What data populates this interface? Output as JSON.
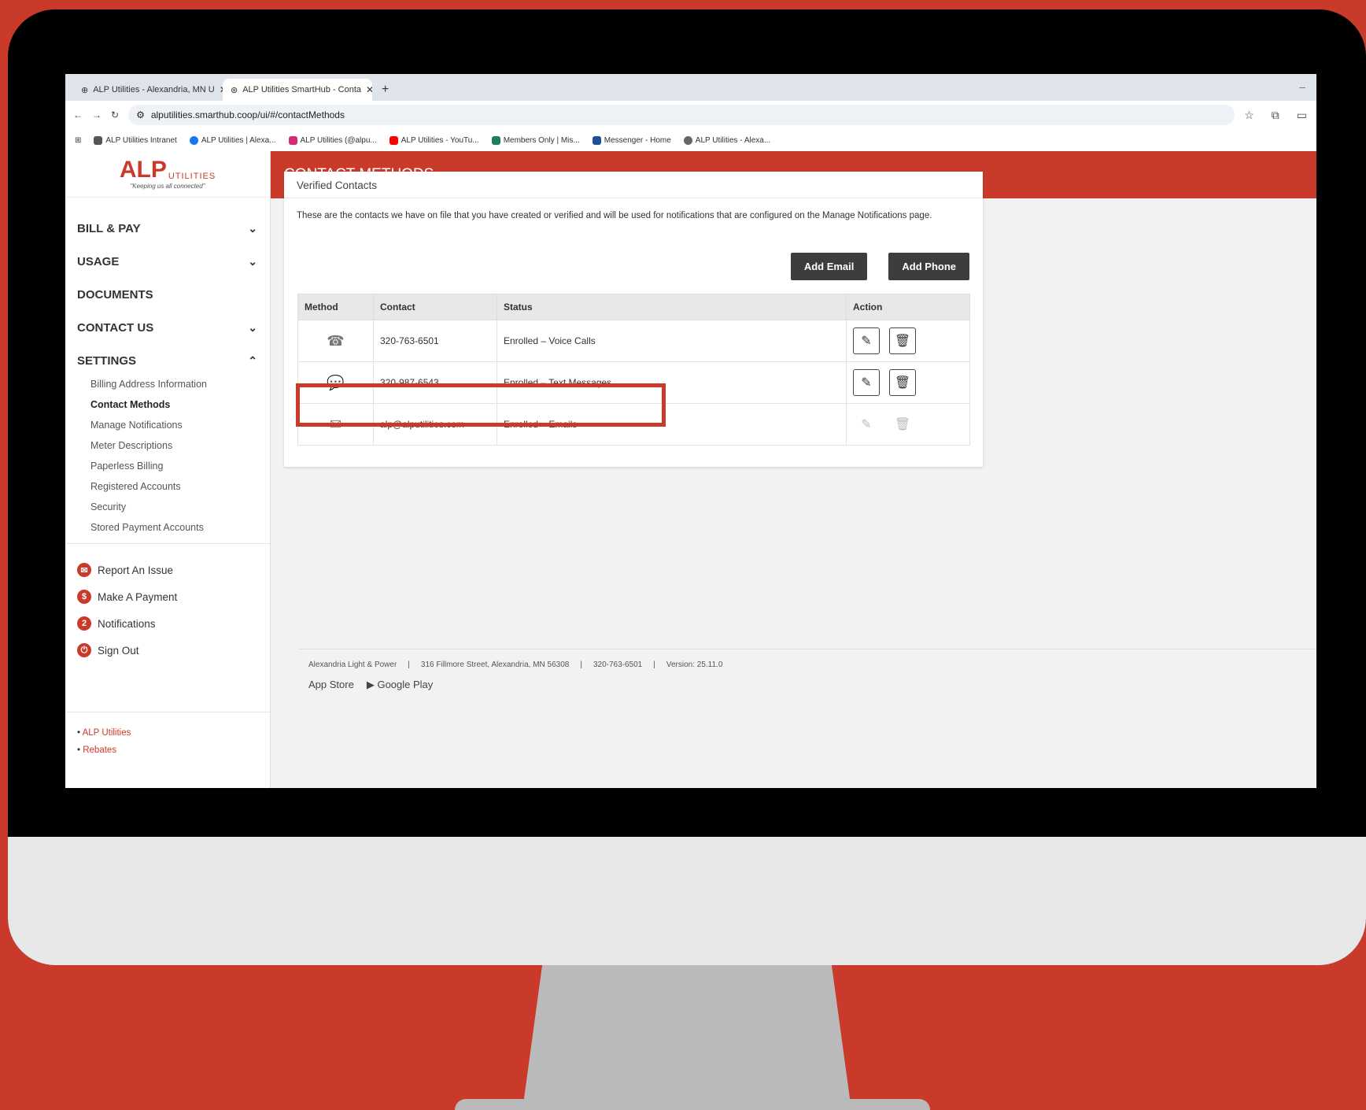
{
  "browser": {
    "tabs": [
      {
        "title": "ALP Utilities - Alexandria, MN U",
        "close": "✕"
      },
      {
        "title": "ALP Utilities SmartHub - Conta",
        "close": "✕"
      }
    ],
    "new_tab": "+",
    "url": "alputilities.smarthub.coop/ui/#/contactMethods",
    "bookmarks": [
      {
        "label": "ALP Utilities Intranet",
        "color": "#555555"
      },
      {
        "label": "ALP Utilities | Alexa...",
        "color": "#1877f2"
      },
      {
        "label": "ALP Utilities (@alpu...",
        "color": "#d62976"
      },
      {
        "label": "ALP Utilities - YouTu...",
        "color": "#ff0000"
      },
      {
        "label": "Members Only | Mis...",
        "color": "#1b7f5b"
      },
      {
        "label": "Messenger - Home",
        "color": "#1f4e9b"
      },
      {
        "label": "ALP Utilities - Alexa...",
        "color": "#666666"
      }
    ]
  },
  "logo": {
    "brand": "ALP",
    "sub": "UTILITIES",
    "tagline": "\"Keeping us all connected\""
  },
  "nav": {
    "bill_pay": "BILL & PAY",
    "usage": "USAGE",
    "documents": "DOCUMENTS",
    "contact_us": "CONTACT US",
    "settings": "SETTINGS",
    "settings_items": [
      "Billing Address Information",
      "Contact Methods",
      "Manage Notifications",
      "Meter Descriptions",
      "Paperless Billing",
      "Registered Accounts",
      "Security",
      "Stored Payment Accounts"
    ]
  },
  "quick_actions": {
    "report": "Report An Issue",
    "payment": "Make A Payment",
    "notifications": "Notifications",
    "notifications_count": "2",
    "signout": "Sign Out"
  },
  "links": {
    "alp": "ALP Utilities",
    "rebates": "Rebates"
  },
  "page": {
    "title": "CONTACT METHODS",
    "card_title": "Verified Contacts",
    "description": "These are the contacts we have on file that you have created or verified and will be used for notifications that are configured on the Manage Notifications page.",
    "add_email": "Add Email",
    "add_phone": "Add Phone",
    "columns": {
      "method": "Method",
      "contact": "Contact",
      "status": "Status",
      "action": "Action"
    },
    "rows": [
      {
        "icon": "phone-icon",
        "contact": "320-763-6501",
        "status": "Enrolled – Voice Calls"
      },
      {
        "icon": "text-message-icon",
        "contact": "320-987-6543",
        "status": "Enrolled – Text Messages"
      },
      {
        "icon": "email-icon",
        "contact": "alp@alputilities.com",
        "status": "Enrolled – Emails"
      }
    ]
  },
  "footer": {
    "company": "Alexandria Light & Power",
    "address": "316 Fillmore Street, Alexandria, MN 56308",
    "phone": "320-763-6501",
    "version": "Version: 25.11.0",
    "app_store": "App Store",
    "google_play": "Google Play",
    "sep": "|"
  },
  "colors": {
    "brand_red": "#c93a2b",
    "button_dark": "#3d3d3d"
  }
}
